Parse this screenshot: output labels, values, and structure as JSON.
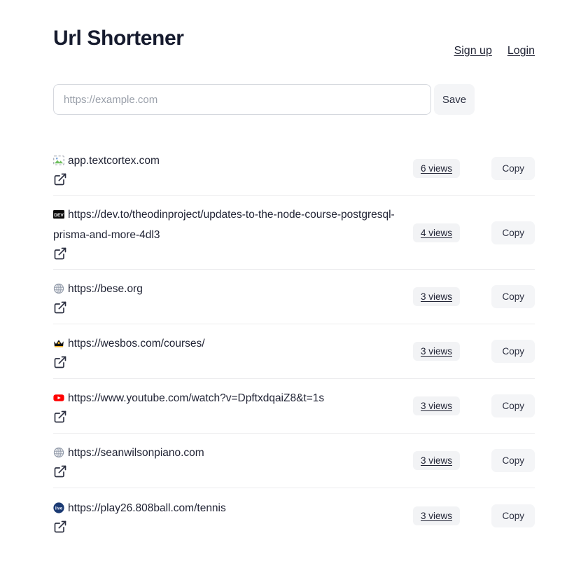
{
  "header": {
    "title": "Url Shortener",
    "nav": [
      {
        "label": "Sign up",
        "name": "signup-link"
      },
      {
        "label": "Login",
        "name": "login-link"
      }
    ]
  },
  "form": {
    "placeholder": "https://example.com",
    "value": "",
    "save_label": "Save"
  },
  "links": [
    {
      "url": "app.textcortex.com",
      "favicon": "broken-image-icon",
      "views_label": "6 views",
      "views_count": 6,
      "copy_label": "Copy"
    },
    {
      "url": "https://dev.to/theodinproject/updates-to-the-node-course-postgresql-prisma-and-more-4dl3",
      "favicon": "devto-icon",
      "views_label": "4 views",
      "views_count": 4,
      "copy_label": "Copy"
    },
    {
      "url": "https://bese.org",
      "favicon": "globe-icon",
      "views_label": "3 views",
      "views_count": 3,
      "copy_label": "Copy"
    },
    {
      "url": "https://wesbos.com/courses/",
      "favicon": "crown-icon",
      "views_label": "3 views",
      "views_count": 3,
      "copy_label": "Copy"
    },
    {
      "url": "https://www.youtube.com/watch?v=DpftxdqaiZ8&t=1s",
      "favicon": "youtube-icon",
      "views_label": "3 views",
      "views_count": 3,
      "copy_label": "Copy"
    },
    {
      "url": "https://seanwilsonpiano.com",
      "favicon": "globe-icon",
      "views_label": "3 views",
      "views_count": 3,
      "copy_label": "Copy"
    },
    {
      "url": "https://play26.808ball.com/tennis",
      "favicon": "blue-circle-icon",
      "views_label": "3 views",
      "views_count": 3,
      "copy_label": "Copy"
    }
  ],
  "colors": {
    "page_background": "#ffffff",
    "text": "#1f2233",
    "title": "#161b2e",
    "button_background": "#f4f5f7",
    "badge_background": "#f2f3f5",
    "divider": "#ececee",
    "input_border": "#d5d8de",
    "placeholder": "#9aa0aa",
    "youtube_red": "#ff0000",
    "devto_black": "#0a0a0a",
    "blue_circle": "#1b3a73"
  }
}
